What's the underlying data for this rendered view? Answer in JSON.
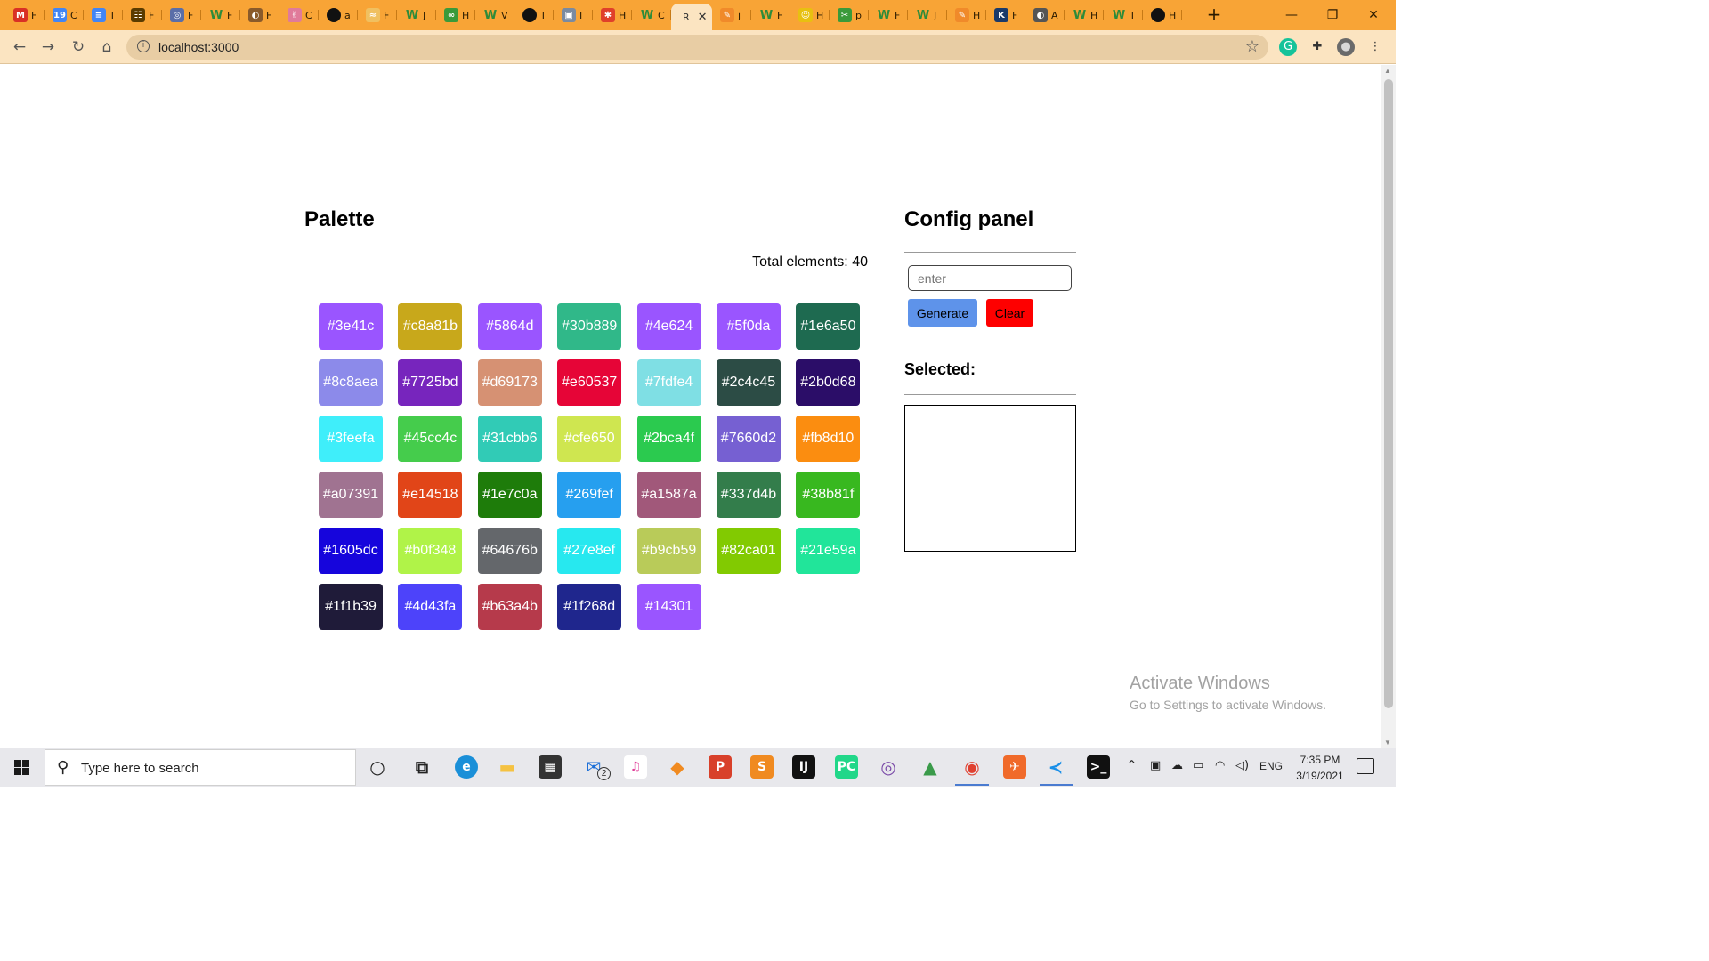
{
  "browser": {
    "tabs": [
      {
        "label": "F",
        "icon": "gmail-icon",
        "color": "#d93025",
        "glyph": "M"
      },
      {
        "label": "C",
        "icon": "calendar-icon",
        "color": "#4285f4",
        "glyph": "19"
      },
      {
        "label": "T",
        "icon": "docs-icon",
        "color": "#4285f4",
        "glyph": "≡"
      },
      {
        "label": "F",
        "icon": "page-icon",
        "color": "#5a3b00",
        "glyph": "☷"
      },
      {
        "label": "F",
        "icon": "globe-icon",
        "color": "#5a6ea8",
        "glyph": "◎"
      },
      {
        "label": "F",
        "icon": "w-icon",
        "color": "#2e8b3a",
        "glyph": "W"
      },
      {
        "label": "F",
        "icon": "globe-icon",
        "color": "#8a5a2a",
        "glyph": "◐"
      },
      {
        "label": "C",
        "icon": "hand-icon",
        "color": "#e07a9a",
        "glyph": "✌"
      },
      {
        "label": "a",
        "icon": "github-icon",
        "color": "#111111",
        "glyph": "●"
      },
      {
        "label": "F",
        "icon": "wave-icon",
        "color": "#f0c060",
        "glyph": "≈"
      },
      {
        "label": "J",
        "icon": "w-icon",
        "color": "#2e8b3a",
        "glyph": "W"
      },
      {
        "label": "H",
        "icon": "infinity-icon",
        "color": "#3a9a3a",
        "glyph": "∞"
      },
      {
        "label": "V",
        "icon": "w-icon",
        "color": "#2e8b3a",
        "glyph": "W"
      },
      {
        "label": "T",
        "icon": "github-icon",
        "color": "#111111",
        "glyph": "●"
      },
      {
        "label": "I",
        "icon": "box-icon",
        "color": "#7a8aa0",
        "glyph": "▣"
      },
      {
        "label": "H",
        "icon": "asterisk-icon",
        "color": "#e0402a",
        "glyph": "✱"
      },
      {
        "label": "C",
        "icon": "w-icon",
        "color": "#2e8b3a",
        "glyph": "W"
      },
      {
        "label": "R",
        "icon": "react-icon",
        "color": "#fbe4c1",
        "glyph": "",
        "active": true,
        "close": "✕"
      },
      {
        "label": "j",
        "icon": "pen-icon",
        "color": "#f08a2a",
        "glyph": "✎"
      },
      {
        "label": "F",
        "icon": "w-icon",
        "color": "#2e8b3a",
        "glyph": "W"
      },
      {
        "label": "H",
        "icon": "minion-icon",
        "color": "#e8c010",
        "glyph": "☺"
      },
      {
        "label": "p",
        "icon": "scissors-icon",
        "color": "#3a9a3a",
        "glyph": "✂"
      },
      {
        "label": "F",
        "icon": "w-icon",
        "color": "#2e8b3a",
        "glyph": "W"
      },
      {
        "label": "J",
        "icon": "w-icon",
        "color": "#2e8b3a",
        "glyph": "W"
      },
      {
        "label": "H",
        "icon": "pen-icon",
        "color": "#f08a2a",
        "glyph": "✎"
      },
      {
        "label": "F",
        "icon": "code-icon",
        "color": "#1a3a6a",
        "glyph": "K"
      },
      {
        "label": "A",
        "icon": "globe-icon",
        "color": "#555555",
        "glyph": "◐"
      },
      {
        "label": "H",
        "icon": "w-icon",
        "color": "#2e8b3a",
        "glyph": "W"
      },
      {
        "label": "T",
        "icon": "w-icon",
        "color": "#2e8b3a",
        "glyph": "W"
      },
      {
        "label": "H",
        "icon": "github-icon",
        "color": "#111111",
        "glyph": "●"
      }
    ],
    "new_tab": "+",
    "window_controls": {
      "minimize": "—",
      "restore": "❐",
      "close": "✕"
    },
    "nav": {
      "back": "←",
      "forward": "→",
      "reload": "↻",
      "home": "⌂"
    },
    "address": "localhost:3000",
    "info_glyph": "i",
    "star_glyph": "☆",
    "extensions": [
      {
        "name": "grammarly-icon",
        "glyph": "G",
        "color": "#15c39a"
      },
      {
        "name": "puzzle-icon",
        "glyph": "✚",
        "color": "#333333"
      },
      {
        "name": "avatar-icon",
        "glyph": "●",
        "color": "#6a6a6a"
      },
      {
        "name": "menu-icon",
        "glyph": "⋮",
        "color": "#333333"
      }
    ]
  },
  "palette": {
    "title": "Palette",
    "total_label": "Total elements: 40",
    "swatches": [
      {
        "label": "#3e41c",
        "color": "#9a55ff"
      },
      {
        "label": "#c8a81b",
        "color": "#c8a81b"
      },
      {
        "label": "#5864d",
        "color": "#9a55ff"
      },
      {
        "label": "#30b889",
        "color": "#30b889"
      },
      {
        "label": "#4e624",
        "color": "#9a55ff"
      },
      {
        "label": "#5f0da",
        "color": "#9a55ff"
      },
      {
        "label": "#1e6a50",
        "color": "#1e6a50"
      },
      {
        "label": "#8c8aea",
        "color": "#8c8aea"
      },
      {
        "label": "#7725bd",
        "color": "#7725bd"
      },
      {
        "label": "#d69173",
        "color": "#d69173"
      },
      {
        "label": "#e60537",
        "color": "#e60537"
      },
      {
        "label": "#7fdfe4",
        "color": "#7fdfe4"
      },
      {
        "label": "#2c4c45",
        "color": "#2c4c45"
      },
      {
        "label": "#2b0d68",
        "color": "#2b0d68"
      },
      {
        "label": "#3feefa",
        "color": "#3feefa"
      },
      {
        "label": "#45cc4c",
        "color": "#45cc4c"
      },
      {
        "label": "#31cbb6",
        "color": "#31cbb6"
      },
      {
        "label": "#cfe650",
        "color": "#cfe650"
      },
      {
        "label": "#2bca4f",
        "color": "#2bca4f"
      },
      {
        "label": "#7660d2",
        "color": "#7660d2"
      },
      {
        "label": "#fb8d10",
        "color": "#fb8d10"
      },
      {
        "label": "#a07391",
        "color": "#a07391"
      },
      {
        "label": "#e14518",
        "color": "#e14518"
      },
      {
        "label": "#1e7c0a",
        "color": "#1e7c0a"
      },
      {
        "label": "#269fef",
        "color": "#269fef"
      },
      {
        "label": "#a1587a",
        "color": "#a1587a"
      },
      {
        "label": "#337d4b",
        "color": "#337d4b"
      },
      {
        "label": "#38b81f",
        "color": "#38b81f"
      },
      {
        "label": "#1605dc",
        "color": "#1605dc"
      },
      {
        "label": "#b0f348",
        "color": "#b0f348"
      },
      {
        "label": "#64676b",
        "color": "#64676b"
      },
      {
        "label": "#27e8ef",
        "color": "#27e8ef"
      },
      {
        "label": "#b9cb59",
        "color": "#b9cb59"
      },
      {
        "label": "#82ca01",
        "color": "#82ca01"
      },
      {
        "label": "#21e59a",
        "color": "#21e59a"
      },
      {
        "label": "#1f1b39",
        "color": "#1f1b39"
      },
      {
        "label": "#4d43fa",
        "color": "#4d43fa"
      },
      {
        "label": "#b63a4b",
        "color": "#b63a4b"
      },
      {
        "label": "#1f268d",
        "color": "#1f268d"
      },
      {
        "label": "#14301",
        "color": "#9a55ff"
      }
    ]
  },
  "config": {
    "title": "Config panel",
    "input_placeholder": "enter",
    "input_value": "",
    "generate_label": "Generate",
    "clear_label": "Clear",
    "selected_title": "Selected:"
  },
  "watermark": {
    "line1": "Activate Windows",
    "line2": "Go to Settings to activate Windows."
  },
  "taskbar": {
    "search_placeholder": "Type here to search",
    "apps": [
      {
        "name": "cortana-icon",
        "glyph": "○",
        "color": "#222222",
        "bg": "transparent"
      },
      {
        "name": "task-view-icon",
        "glyph": "⧉",
        "color": "#222222",
        "bg": "transparent"
      },
      {
        "name": "edge-icon",
        "glyph": "e",
        "color": "#ffffff",
        "bg": "#1a8fd8"
      },
      {
        "name": "file-explorer-icon",
        "glyph": "▬",
        "color": "#f5c242",
        "bg": "transparent"
      },
      {
        "name": "store-icon",
        "glyph": "▦",
        "color": "#ffffff",
        "bg": "#333333"
      },
      {
        "name": "mail-icon",
        "glyph": "✉",
        "color": "#1a6ed8",
        "bg": "transparent"
      },
      {
        "name": "itunes-icon",
        "glyph": "♫",
        "color": "#e0409a",
        "bg": "#ffffff"
      },
      {
        "name": "fl-studio-icon",
        "glyph": "◆",
        "color": "#f08a20",
        "bg": "transparent"
      },
      {
        "name": "podcast-icon",
        "glyph": "P",
        "color": "#ffffff",
        "bg": "#d8402a"
      },
      {
        "name": "sublime-icon",
        "glyph": "S",
        "color": "#ffffff",
        "bg": "#f08a20"
      },
      {
        "name": "intellij-icon",
        "glyph": "IJ",
        "color": "#ffffff",
        "bg": "#111111"
      },
      {
        "name": "pycharm-icon",
        "glyph": "PC",
        "color": "#ffffff",
        "bg": "#21d789"
      },
      {
        "name": "tor-icon",
        "glyph": "◎",
        "color": "#7a4aa8",
        "bg": "transparent"
      },
      {
        "name": "android-studio-icon",
        "glyph": "▲",
        "color": "#3a9a4a",
        "bg": "transparent"
      },
      {
        "name": "chrome-icon",
        "glyph": "◉",
        "color": "#e04030",
        "bg": "transparent"
      },
      {
        "name": "postman-icon",
        "glyph": "✈",
        "color": "#ffffff",
        "bg": "#f06a2a"
      },
      {
        "name": "vscode-icon",
        "glyph": "≺",
        "color": "#1a8fe8",
        "bg": "transparent"
      },
      {
        "name": "terminal-icon",
        "glyph": ">_",
        "color": "#ffffff",
        "bg": "#111111"
      }
    ],
    "mail_badge": "2",
    "tray": {
      "chevron": "^",
      "language": "ENG",
      "wifi": "◠",
      "volume": "🔈"
    },
    "time": "7:35 PM",
    "date": "3/19/2021"
  }
}
